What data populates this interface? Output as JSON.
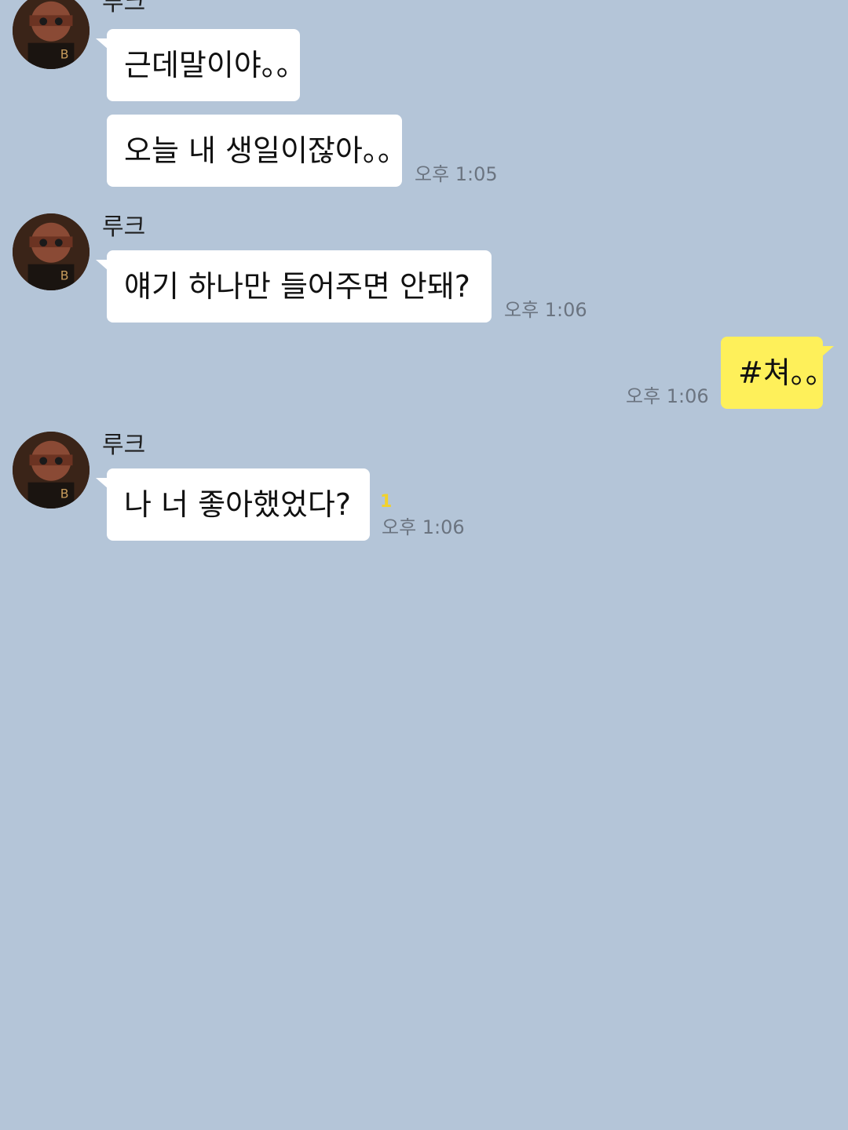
{
  "chat": {
    "colors": {
      "background": "#b4c5d8",
      "bubble_other": "#ffffff",
      "bubble_me": "#fef05a",
      "timestamp": "#6b7480",
      "unread": "#f2d22a"
    },
    "groups": [
      {
        "sender": "루크",
        "messages": [
          {
            "text": "근데말이야。。"
          },
          {
            "text": "오늘 내 생일이잖아。。",
            "time": "오후 1:05"
          }
        ]
      },
      {
        "sender": "루크",
        "messages": [
          {
            "text": "얘기 하나만 들어주면 안돼?",
            "time": "오후 1:06"
          }
        ]
      },
      {
        "sender": "me",
        "messages": [
          {
            "text": "#쳐。。",
            "time": "오후 1:06"
          }
        ]
      },
      {
        "sender": "루크",
        "messages": [
          {
            "text": "나 너 좋아했었다?",
            "time": "오후 1:06",
            "unread": "1"
          }
        ]
      }
    ]
  }
}
